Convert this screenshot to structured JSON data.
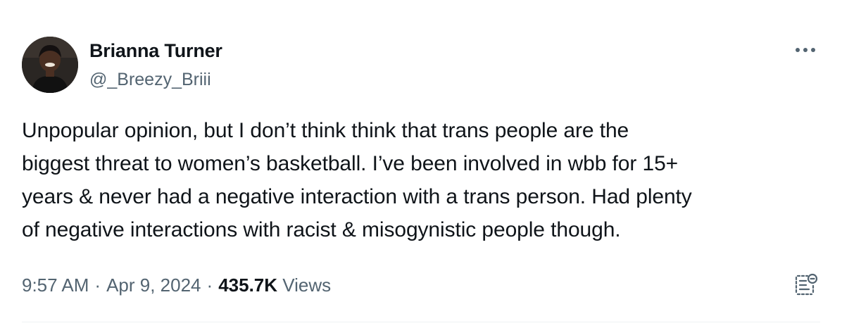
{
  "tweet": {
    "author": {
      "display_name": "Brianna Turner",
      "handle": "@_Breezy_Briii"
    },
    "text_lines": [
      "Unpopular opinion, but I don’t think think that trans people are the",
      "biggest threat to women’s basketball. I’ve been involved in wbb for 15+",
      "years & never had a negative interaction with a trans person. Had plenty",
      "of negative interactions with racist & misogynistic people though."
    ],
    "meta": {
      "time": "9:57 AM",
      "separator": "·",
      "date": "Apr 9, 2024",
      "views_count": "435.7K",
      "views_label": "Views"
    },
    "icons": {
      "more": "more-options-icon",
      "reader": "reader-mode-icon"
    },
    "colors": {
      "text_primary": "#0f1419",
      "text_secondary": "#536471",
      "divider": "#eff3f4"
    }
  }
}
